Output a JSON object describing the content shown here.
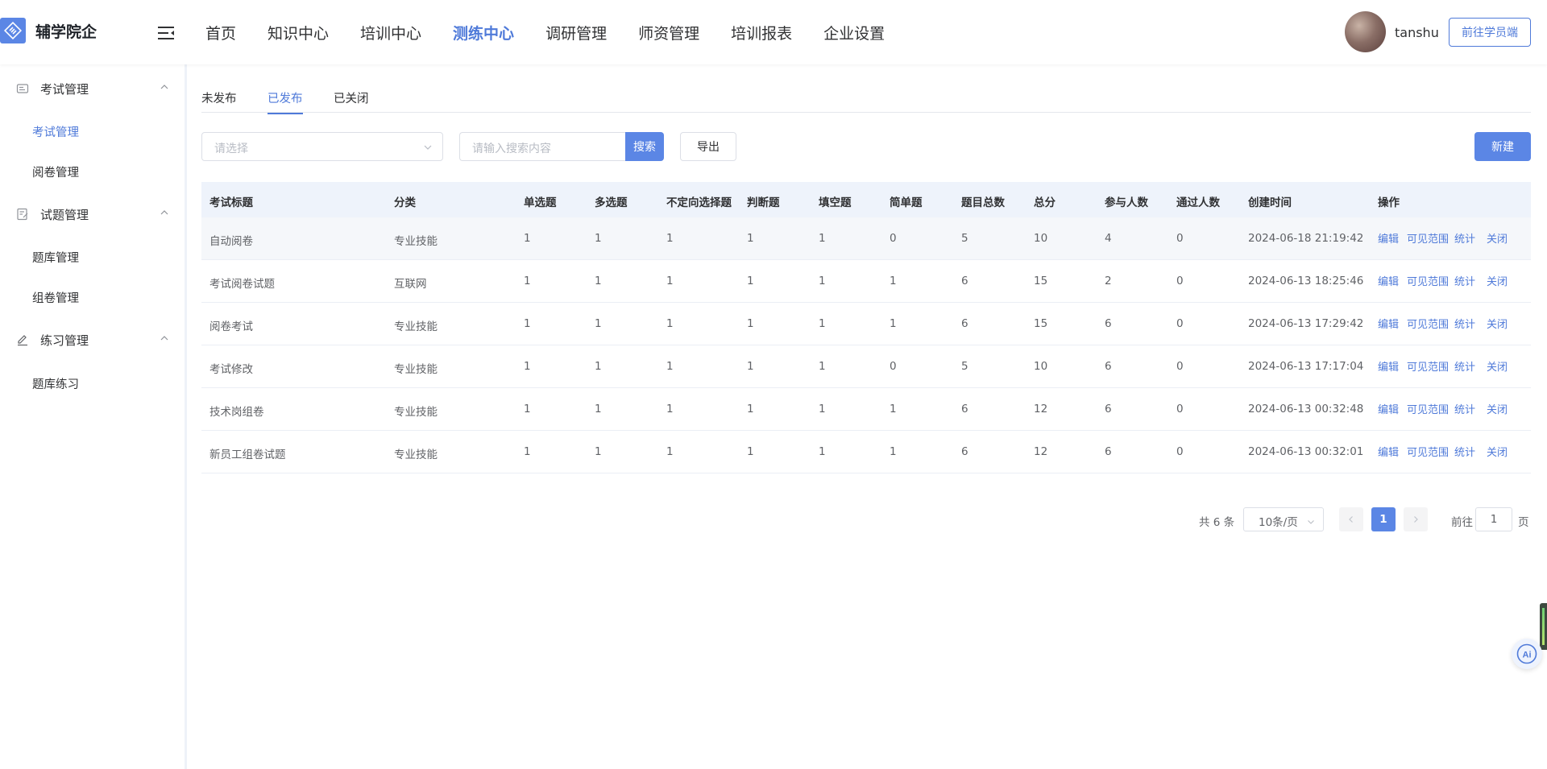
{
  "header": {
    "logo_text": "辅学院企",
    "nav": [
      "首页",
      "知识中心",
      "培训中心",
      "测练中心",
      "调研管理",
      "师资管理",
      "培训报表",
      "企业设置"
    ],
    "active_nav": "测练中心",
    "username": "tanshu",
    "go_student_label": "前往学员端"
  },
  "sidebar": {
    "groups": [
      {
        "label": "考试管理",
        "icon": "exam-icon",
        "items": [
          "考试管理",
          "阅卷管理"
        ]
      },
      {
        "label": "试题管理",
        "icon": "question-icon",
        "items": [
          "题库管理",
          "组卷管理"
        ]
      },
      {
        "label": "练习管理",
        "icon": "edit-icon",
        "items": [
          "题库练习"
        ]
      }
    ],
    "active_item": "考试管理"
  },
  "tabs": [
    "未发布",
    "已发布",
    "已关闭"
  ],
  "active_tab": "已发布",
  "filters": {
    "select_placeholder": "请选择",
    "search_placeholder": "请输入搜索内容",
    "search_label": "搜索",
    "export_label": "导出",
    "new_label": "新建"
  },
  "table": {
    "headers": [
      "考试标题",
      "分类",
      "单选题",
      "多选题",
      "不定向选择题",
      "判断题",
      "填空题",
      "简单题",
      "题目总数",
      "总分",
      "参与人数",
      "通过人数",
      "创建时间",
      "操作"
    ],
    "rows": [
      [
        "自动阅卷",
        "专业技能",
        "1",
        "1",
        "1",
        "1",
        "1",
        "0",
        "5",
        "10",
        "4",
        "0",
        "2024-06-18 21:19:42"
      ],
      [
        "考试阅卷试题",
        "互联网",
        "1",
        "1",
        "1",
        "1",
        "1",
        "1",
        "6",
        "15",
        "2",
        "0",
        "2024-06-13 18:25:46"
      ],
      [
        "阅卷考试",
        "专业技能",
        "1",
        "1",
        "1",
        "1",
        "1",
        "1",
        "6",
        "15",
        "6",
        "0",
        "2024-06-13 17:29:42"
      ],
      [
        "考试修改",
        "专业技能",
        "1",
        "1",
        "1",
        "1",
        "1",
        "0",
        "5",
        "10",
        "6",
        "0",
        "2024-06-13 17:17:04"
      ],
      [
        "技术岗组卷",
        "专业技能",
        "1",
        "1",
        "1",
        "1",
        "1",
        "1",
        "6",
        "12",
        "6",
        "0",
        "2024-06-13 00:32:48"
      ],
      [
        "新员工组卷试题",
        "专业技能",
        "1",
        "1",
        "1",
        "1",
        "1",
        "1",
        "6",
        "12",
        "6",
        "0",
        "2024-06-13 00:32:01"
      ]
    ],
    "actions": [
      "编辑",
      "可见范围",
      "统计",
      "关闭"
    ]
  },
  "pagination": {
    "total_text": "共 6 条",
    "page_size": "10条/页",
    "current_page": "1",
    "goto_label": "前往",
    "goto_value": "1",
    "page_suffix": "页"
  },
  "colors": {
    "accent": "#5b86e5",
    "link": "#4f7ad9",
    "header_bg": "#eef3fb"
  }
}
